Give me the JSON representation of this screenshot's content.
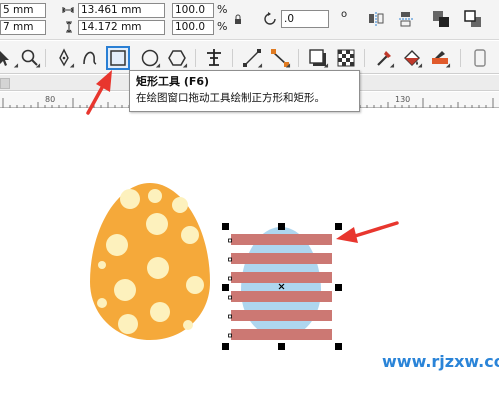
{
  "property_bar": {
    "x_value": "5 mm",
    "y_value": "7 mm",
    "width_value": "13.461 mm",
    "height_value": "14.172 mm",
    "scale_x_value": "100.0",
    "scale_y_value": "100.0",
    "percent_x": "%",
    "percent_y": "%",
    "rotation_value": ".0",
    "degree_symbol": "o"
  },
  "toolbox": {
    "tools": [
      "pick-tool",
      "zoom-tool",
      "pen-tool",
      "bezier-tool",
      "rectangle-tool",
      "ellipse-tool",
      "polygon-tool",
      "text-tool",
      "connector-tool",
      "dimension-tool",
      "drop-shadow-tool",
      "transparency-tool",
      "eyedropper-tool",
      "interactive-fill-tool",
      "smart-fill-tool"
    ],
    "active_tool": "rectangle-tool"
  },
  "tooltip": {
    "title": "矩形工具 (F6)",
    "description": "在绘图窗口拖动工具绘制正方形和矩形。"
  },
  "ruler": {
    "labels": [
      "80",
      "130"
    ]
  },
  "colors": {
    "egg_orange": "#f5a93a",
    "egg_dots": "#fdf1bd",
    "egg_blue": "#aed6ef",
    "stripes": "#cc7873",
    "arrow_red": "#e8362e",
    "active_tool_blue": "#2a7fd4"
  },
  "watermark": "www.rjzxw.com"
}
